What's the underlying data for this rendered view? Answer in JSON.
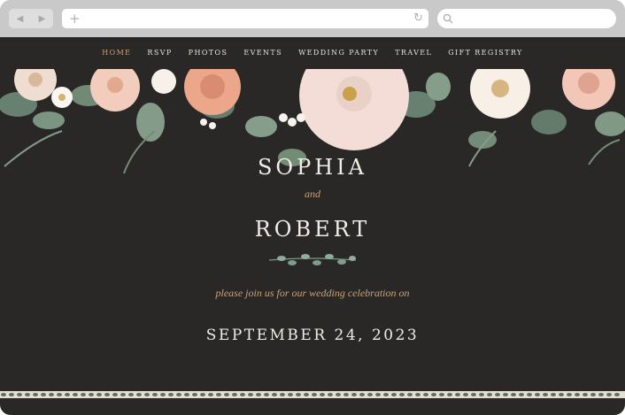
{
  "browser": {
    "back_glyph": "◀",
    "forward_glyph": "▶",
    "new_tab_glyph": "+",
    "reload_glyph": "↻",
    "icons": [
      "back-arrow-icon",
      "forward-arrow-icon",
      "plus-icon",
      "reload-icon",
      "search-icon"
    ]
  },
  "nav": {
    "items": [
      {
        "label": "HOME",
        "active": true
      },
      {
        "label": "RSVP",
        "active": false
      },
      {
        "label": "PHOTOS",
        "active": false
      },
      {
        "label": "EVENTS",
        "active": false
      },
      {
        "label": "WEDDING PARTY",
        "active": false
      },
      {
        "label": "TRAVEL",
        "active": false
      },
      {
        "label": "GIFT REGISTRY",
        "active": false
      }
    ]
  },
  "hero": {
    "name1": "SOPHIA",
    "and": "and",
    "name2": "ROBERT",
    "invite": "please join us for our wedding celebration on",
    "date": "SEPTEMBER 24, 2023"
  },
  "colors": {
    "background": "#292827",
    "accent": "#c7a27a",
    "text": "#f1ece6",
    "chrome": "#c9c9c9"
  }
}
